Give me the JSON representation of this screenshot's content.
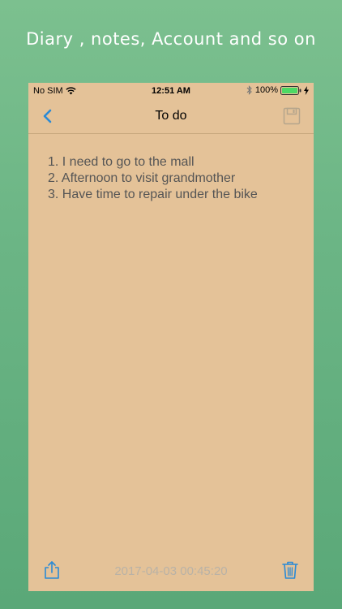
{
  "promo": {
    "caption": "Diary ,  notes,  Account and so on"
  },
  "status_bar": {
    "carrier": "No SIM",
    "time": "12:51 AM",
    "battery": "100%"
  },
  "nav": {
    "title": "To do",
    "back_icon": "chevron-left-icon",
    "save_icon": "floppy-disk-icon"
  },
  "note": {
    "lines": [
      "1. I need to go to the mall",
      "2. Afternoon to visit grandmother",
      "3. Have time to repair under the bike"
    ]
  },
  "toolbar": {
    "timestamp": "2017-04-03 00:45:20",
    "share_icon": "share-icon",
    "trash_icon": "trash-icon"
  },
  "colors": {
    "background": "#6bb585",
    "note_paper": "#e4c298",
    "accent": "#2a8ad6",
    "disabled": "#b9b2a6"
  }
}
